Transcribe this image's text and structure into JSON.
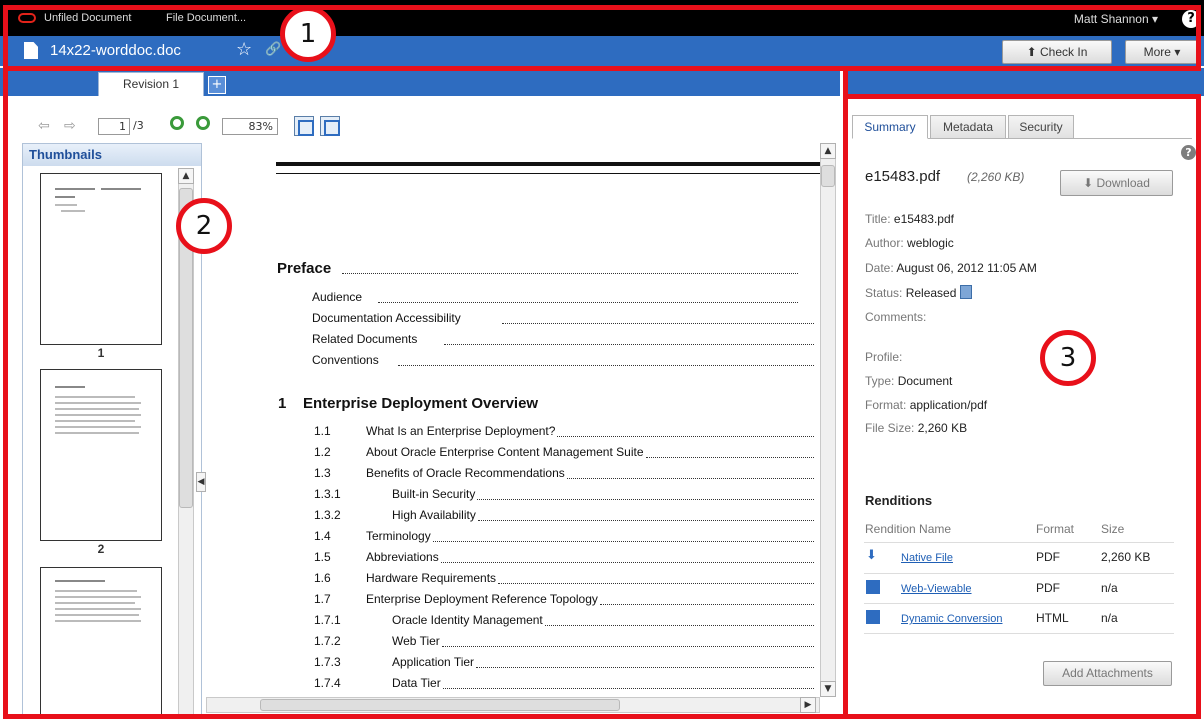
{
  "top_bar": {
    "breadcrumb_1": "Unfiled Document",
    "breadcrumb_2": "File Document...",
    "user_name": "Matt Shannon ▾",
    "help": "?"
  },
  "doc_header": {
    "title": "14x22-worddoc.doc",
    "star": "☆",
    "link": "🔗",
    "check_in_label": "⬆ Check In",
    "more_label": "More ▾"
  },
  "viewer": {
    "revision_tab": "Revision 1",
    "add_tab": "+",
    "page_current": "1",
    "page_total": "/3",
    "zoom": "83%",
    "thumbnails_title": "Thumbnails",
    "thumbnail_numbers": [
      "1",
      "2"
    ]
  },
  "document": {
    "preface": "Preface",
    "preface_items": [
      "Audience",
      "Documentation Accessibility",
      "Related Documents",
      "Conventions"
    ],
    "chapter_num": "1",
    "chapter_title": "Enterprise Deployment Overview",
    "entries": [
      {
        "num": "1.1",
        "text": "What Is an Enterprise Deployment?"
      },
      {
        "num": "1.2",
        "text": "About Oracle Enterprise Content Management Suite"
      },
      {
        "num": "1.3",
        "text": "Benefits of Oracle Recommendations"
      },
      {
        "num": "1.3.1",
        "text": "Built-in Security"
      },
      {
        "num": "1.3.2",
        "text": "High Availability"
      },
      {
        "num": "1.4",
        "text": "Terminology"
      },
      {
        "num": "1.5",
        "text": "Abbreviations"
      },
      {
        "num": "1.6",
        "text": "Hardware Requirements"
      },
      {
        "num": "1.7",
        "text": "Enterprise Deployment Reference Topology"
      },
      {
        "num": "1.7.1",
        "text": "Oracle Identity Management"
      },
      {
        "num": "1.7.2",
        "text": "Web Tier"
      },
      {
        "num": "1.7.3",
        "text": "Application Tier"
      },
      {
        "num": "1.7.4",
        "text": "Data Tier"
      }
    ]
  },
  "info_panel": {
    "tabs": [
      "Summary",
      "Metadata",
      "Security"
    ],
    "help": "?",
    "file_name": "e15483.pdf",
    "file_size": "(2,260 KB)",
    "download_label": "⬇ Download",
    "props": [
      {
        "k": "Title:",
        "v": "e15483.pdf"
      },
      {
        "k": "Author:",
        "v": "weblogic"
      },
      {
        "k": "Date:",
        "v": "August 06, 2012 11:05 AM"
      },
      {
        "k": "Status:",
        "v": "Released"
      },
      {
        "k": "Comments:",
        "v": ""
      },
      {
        "k": "Profile:",
        "v": ""
      },
      {
        "k": "Type:",
        "v": "Document"
      },
      {
        "k": "Format:",
        "v": "application/pdf"
      },
      {
        "k": "File Size:",
        "v": "2,260 KB"
      }
    ],
    "renditions_title": "Renditions",
    "rendition_headers": [
      "Rendition Name",
      "Format",
      "Size"
    ],
    "renditions": [
      {
        "name": "Native File",
        "format": "PDF",
        "size": "2,260 KB"
      },
      {
        "name": "Web-Viewable",
        "format": "PDF",
        "size": "n/a"
      },
      {
        "name": "Dynamic Conversion",
        "format": "HTML",
        "size": "n/a"
      }
    ],
    "add_attachments_label": "Add Attachments"
  },
  "callouts": [
    "1",
    "2",
    "3"
  ],
  "colors": {
    "accent_blue": "#2e6cc0",
    "callout_red": "#e8101a"
  }
}
